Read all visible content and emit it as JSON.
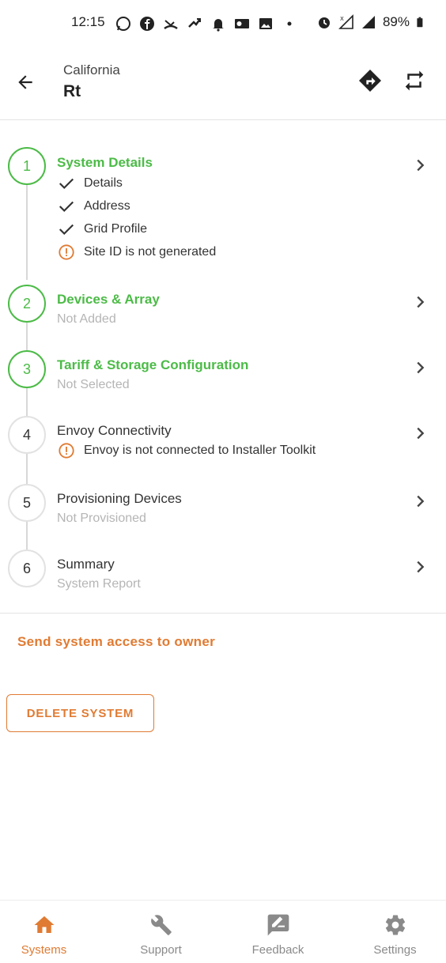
{
  "status_bar": {
    "time": "12:15",
    "battery": "89%",
    "icons": [
      "whatsapp-icon",
      "facebook-icon",
      "missed-call-icon",
      "signal-boost-icon",
      "bell-icon",
      "outlook-icon",
      "image-icon",
      "dot-icon",
      "alarm-icon",
      "signal-x-icon",
      "signal-icon",
      "battery-icon"
    ]
  },
  "header": {
    "state": "California",
    "system_name": "Rt"
  },
  "steps": [
    {
      "number": "1",
      "title": "System Details",
      "status": "done",
      "checks": [
        {
          "label": "Details",
          "icon": "check-icon"
        },
        {
          "label": "Address",
          "icon": "check-icon"
        },
        {
          "label": "Grid Profile",
          "icon": "check-icon"
        },
        {
          "label": "Site ID is not generated",
          "icon": "warning-icon"
        }
      ]
    },
    {
      "number": "2",
      "title": "Devices & Array",
      "status": "done",
      "subtitle": "Not Added"
    },
    {
      "number": "3",
      "title": "Tariff & Storage Configuration",
      "status": "done",
      "subtitle": "Not Selected"
    },
    {
      "number": "4",
      "title": "Envoy Connectivity",
      "status": "todo",
      "warning": "Envoy is not connected to Installer Toolkit"
    },
    {
      "number": "5",
      "title": "Provisioning Devices",
      "status": "todo",
      "subtitle": "Not Provisioned"
    },
    {
      "number": "6",
      "title": "Summary",
      "status": "todo",
      "subtitle": "System Report"
    }
  ],
  "actions": {
    "send_access": "Send system access to owner",
    "delete_system": "DELETE SYSTEM"
  },
  "bottom_nav": [
    {
      "label": "Systems",
      "icon": "home-icon",
      "active": true
    },
    {
      "label": "Support",
      "icon": "wrench-icon",
      "active": false
    },
    {
      "label": "Feedback",
      "icon": "feedback-icon",
      "active": false
    },
    {
      "label": "Settings",
      "icon": "gear-icon",
      "active": false
    }
  ],
  "colors": {
    "accent": "#e07b33",
    "success": "#4cbb47",
    "muted": "#b5b5b5"
  }
}
